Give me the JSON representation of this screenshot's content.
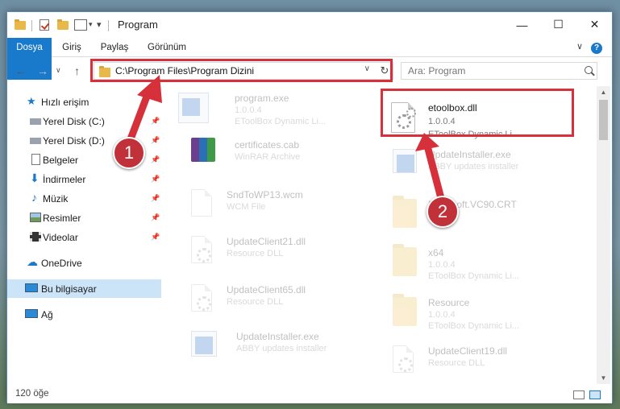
{
  "window": {
    "title": "Program",
    "minimize": "—",
    "maximize": "☐",
    "close": "✕"
  },
  "ribbon": {
    "tabs": [
      "Dosya",
      "Giriş",
      "Paylaş",
      "Görünüm"
    ],
    "toggle": "∨",
    "help": "?"
  },
  "nav": {
    "back": "←",
    "forward": "→",
    "recent": "∨",
    "up": "↑",
    "address": "C:\\Program Files\\Program Dizini",
    "address_drop": "∨",
    "refresh": "↻",
    "search_placeholder": "Ara: Program"
  },
  "sidebar": {
    "quick_access": "Hızlı erişim",
    "items": [
      {
        "label": "Yerel Disk (C:)"
      },
      {
        "label": "Yerel Disk (D:)"
      },
      {
        "label": "Belgeler"
      },
      {
        "label": "İndirmeler"
      },
      {
        "label": "Müzik"
      },
      {
        "label": "Resimler"
      },
      {
        "label": "Videolar"
      }
    ],
    "onedrive": "OneDrive",
    "this_pc": "Bu bilgisayar",
    "network": "Ağ"
  },
  "files": {
    "left": [
      {
        "name": "program.exe",
        "line1": "1.0.0.4",
        "line2": "EToolBox Dynamic Li..."
      },
      {
        "name": "certificates.cab",
        "line1": "WinRAR Archive",
        "line2": ""
      },
      {
        "name": "SndToWP13.wcm",
        "line1": "WCM File",
        "line2": ""
      },
      {
        "name": "UpdateClient21.dll",
        "line1": "Resource DLL",
        "line2": ""
      },
      {
        "name": "UpdateClient65.dll",
        "line1": "Resource DLL",
        "line2": ""
      },
      {
        "name": "UpdateInstaller.exe",
        "line1": "ABBY updates installer",
        "line2": ""
      }
    ],
    "right": [
      {
        "name": "etoolbox.dll",
        "line1": "1.0.0.4",
        "line2": "EToolBox Dynamic Li..."
      },
      {
        "name": "UpdateInstaller.exe",
        "line1": "ABBY updates installer",
        "line2": ""
      },
      {
        "name": "Microsoft.VC90.CRT",
        "line1": "",
        "line2": ""
      },
      {
        "name": "x64",
        "line1": "1.0.0.4",
        "line2": "EToolBox Dynamic Li..."
      },
      {
        "name": "Resource",
        "line1": "1.0.0.4",
        "line2": "EToolBox Dynamic Li..."
      },
      {
        "name": "UpdateClient19.dll",
        "line1": "Resource DLL",
        "line2": ""
      }
    ]
  },
  "status": {
    "count": "120 öğe"
  },
  "annotations": {
    "badge1": "1",
    "badge2": "2",
    "color": "#d6303a"
  }
}
